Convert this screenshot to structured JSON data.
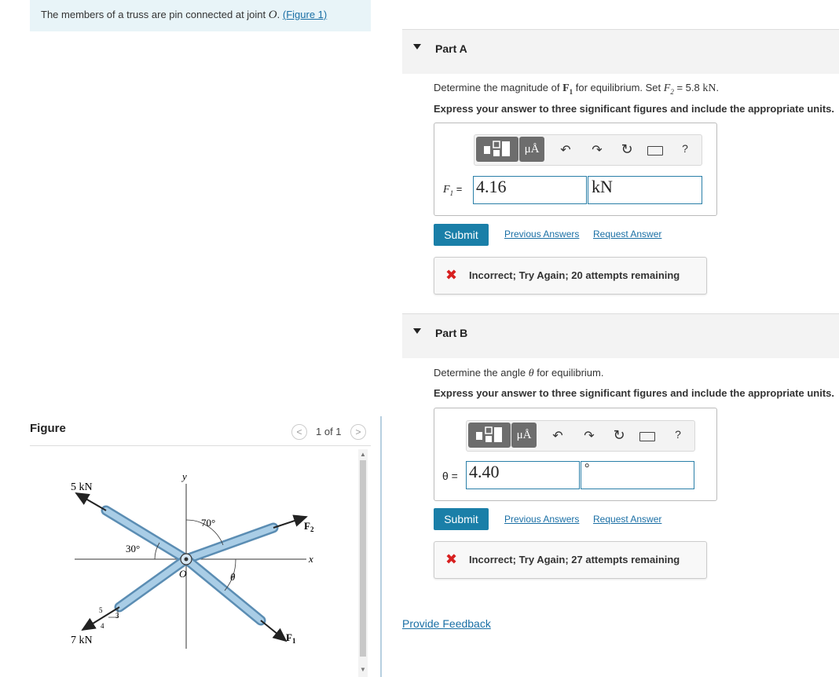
{
  "problem": {
    "text": "The members of a truss are pin connected at joint",
    "joint": "O",
    "period": ".",
    "figure_link": "(Figure 1)"
  },
  "figure_panel": {
    "heading": "Figure",
    "pager": "1 of 1",
    "labels": {
      "five_kn": "5 kN",
      "seven_kn": "7 kN",
      "angle70": "70°",
      "angle30": "30°",
      "y": "y",
      "x": "x",
      "o": "O",
      "theta": "θ",
      "f1": "F",
      "f1_sub": "1",
      "f2": "F",
      "f2_sub": "2",
      "tri_5": "5",
      "tri_4": "4",
      "tri_3": "3"
    }
  },
  "part_a": {
    "title": "Part A",
    "question_pre": "Determine the magnitude of",
    "question_var": "F",
    "question_var_sub": "1",
    "question_mid": "for equilibrium. Set",
    "question_set_var": "F",
    "question_set_sub": "2",
    "question_set_val": "= 5.8",
    "question_unit": "kN",
    "question_end": ".",
    "instruction": "Express your answer to three significant figures and include the appropriate units.",
    "input_label": "F",
    "input_label_sub": "1",
    "input_eq": "=",
    "value": "4.16",
    "units": "kN",
    "submit": "Submit",
    "previous_answers": "Previous Answers",
    "request_answer": "Request Answer",
    "feedback": "Incorrect; Try Again; 20 attempts remaining"
  },
  "part_b": {
    "title": "Part B",
    "question_pre": "Determine the angle",
    "question_var": "θ",
    "question_end": "for equilibrium.",
    "instruction": "Express your answer to three significant figures and include the appropriate units.",
    "input_label": "θ =",
    "value": "4.40",
    "units": "°",
    "submit": "Submit",
    "previous_answers": "Previous Answers",
    "request_answer": "Request Answer",
    "feedback": "Incorrect; Try Again; 27 attempts remaining"
  },
  "toolbar": {
    "units_btn": "μÅ",
    "help": "?"
  },
  "provide_feedback": "Provide Feedback",
  "colors": {
    "accent": "#1a7fa8",
    "link": "#1a6fa5",
    "error": "#d82020",
    "problem_bg": "#e8f4f8",
    "part_bg": "#f3f3f3"
  },
  "icons": [
    "templates-icon",
    "units-icon",
    "undo-icon",
    "redo-icon",
    "reset-icon",
    "keyboard-icon",
    "help-icon",
    "incorrect-x-icon"
  ]
}
